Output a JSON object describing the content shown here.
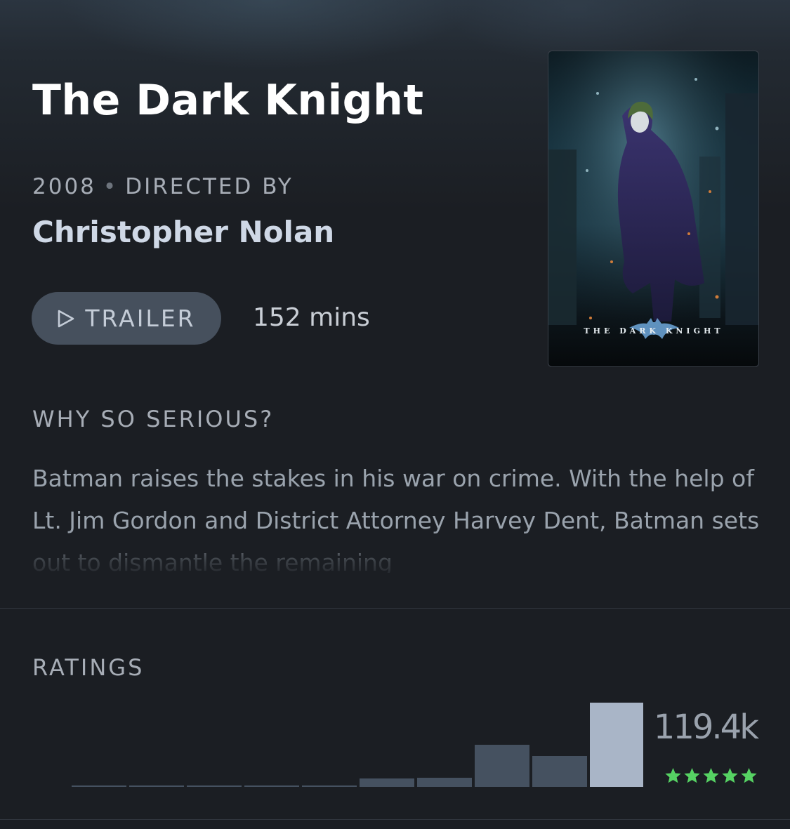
{
  "film": {
    "title": "The Dark Knight",
    "year": "2008",
    "directed_by_label": "DIRECTED BY",
    "director": "Christopher Nolan",
    "runtime": "152 mins",
    "tagline": "WHY SO SERIOUS?",
    "synopsis": "Batman raises the stakes in his war on crime. With the help of Lt. Jim Gordon and District Attorney Harvey Dent, Batman sets out to dismantle the remaining"
  },
  "trailer_button": {
    "label": "TRAILER",
    "icon": "play-icon"
  },
  "poster": {
    "caption": "THE DARK KNIGHT",
    "subject": "Joker standing in a ruined city"
  },
  "ratings": {
    "heading": "RATINGS",
    "total": "119.4k",
    "stars": 5,
    "star_color": "#56d263",
    "bar_color_default": "#455160",
    "bar_color_highlight": "#a9b5c7",
    "distribution": [
      0.012,
      0.012,
      0.012,
      0.012,
      0.012,
      0.1,
      0.105,
      0.5,
      0.37,
      1.0
    ],
    "highlighted_index": 9
  },
  "colors": {
    "background": "#1b1e23",
    "title": "#ffffff",
    "director": "#cfd8e6",
    "muted_text": "#a7adb6"
  }
}
